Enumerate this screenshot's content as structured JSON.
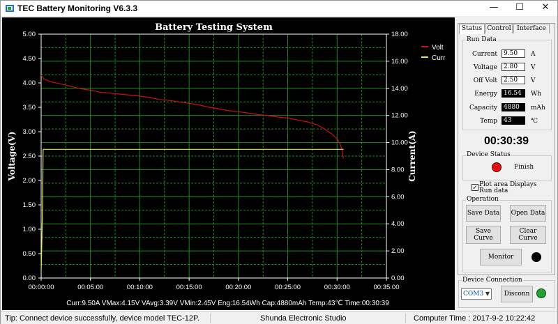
{
  "window": {
    "title": "TEC Battery Monitoring V6.3.3",
    "minimize": "—",
    "maximize": "☐",
    "close": "✕"
  },
  "tabs": [
    {
      "label": "Status",
      "active": true
    },
    {
      "label": "Control",
      "active": false
    },
    {
      "label": "Interface",
      "active": false
    }
  ],
  "run_data": {
    "label": "Run Data",
    "rows": [
      {
        "label": "Current",
        "value": "9.50",
        "unit": "A"
      },
      {
        "label": "Voltage",
        "value": "2.80",
        "unit": "V"
      },
      {
        "label": "Off Volt",
        "value": "2.50",
        "unit": "V"
      },
      {
        "label": "Energy",
        "value": "16.54",
        "unit": "Wh"
      },
      {
        "label": "Capacity",
        "value": "4880",
        "unit": "mAh"
      },
      {
        "label": "Temp",
        "value": "43",
        "unit": "℃"
      }
    ]
  },
  "timer": "00:30:39",
  "device_status": {
    "label": "Device Status",
    "status_text": "Finish",
    "color": "#e01010"
  },
  "plot_option": {
    "checked": true,
    "check_glyph": "✓",
    "label_line1": "Plot area Displays",
    "label_line2": "Run data"
  },
  "operation": {
    "label": "Operation",
    "save_data": "Save Data",
    "open_data": "Open Data",
    "save_curve_1": "Save",
    "save_curve_2": "Curve",
    "clear_curve_1": "Clear",
    "clear_curve_2": "Curve",
    "monitor": "Monitor",
    "monitor_indicator_color": "#000000"
  },
  "device_connection": {
    "label": "Device Connection",
    "port": "COM3",
    "disconnect": "Disconn",
    "indicator_color": "#22a030"
  },
  "status_bar": {
    "tip": "Tip: Connect device successfully, device model TEC-12P.",
    "studio": "Shunda Electronic Studio",
    "computer_time": "Computer Time : 2017-9-2 10:22:42"
  },
  "chart_data": {
    "type": "line",
    "title": "Battery Testing System",
    "ylabel": "Voltage(V)",
    "y2label": "Current(A)",
    "ylim": [
      0,
      5
    ],
    "y2lim": [
      0,
      18
    ],
    "yticks": [
      "0.00",
      "0.50",
      "1.00",
      "1.50",
      "2.00",
      "2.50",
      "3.00",
      "3.50",
      "4.00",
      "4.50",
      "5.00"
    ],
    "y2ticks": [
      "0.00",
      "2.00",
      "4.00",
      "6.00",
      "8.00",
      "10.00",
      "12.00",
      "14.00",
      "16.00",
      "18.00"
    ],
    "xticks": [
      "00:00:00",
      "00:05:00",
      "00:10:00",
      "00:15:00",
      "00:20:00",
      "00:25:00",
      "00:30:00",
      "00:35:00"
    ],
    "xlim_minutes": [
      0,
      35
    ],
    "grid": true,
    "legend_position": "top-right",
    "summary": "Curr:9.50A  VMax:4.15V  VAvg:3.39V  VMin:2.45V  Eng:16.54Wh  Cap:4880mAh  Temp:43℃  Time:00:30:39",
    "colors": {
      "volt": "#cc1010",
      "curr": "#e8e840",
      "grid": "#1e8a1e",
      "axes": "#ffffff"
    },
    "series": [
      {
        "name": "Volt",
        "axis": "left",
        "x_minutes": [
          0,
          0.3,
          1,
          2,
          3,
          4,
          5,
          6,
          7,
          8,
          9,
          10,
          11,
          12,
          13,
          14,
          15,
          16,
          17,
          18,
          19,
          20,
          21,
          22,
          23,
          24,
          25,
          26,
          27,
          28,
          28.5,
          29,
          29.5,
          30,
          30.3,
          30.5,
          30.65
        ],
        "y": [
          4.15,
          4.08,
          4.02,
          3.98,
          3.93,
          3.88,
          3.85,
          3.81,
          3.79,
          3.77,
          3.75,
          3.73,
          3.7,
          3.66,
          3.64,
          3.61,
          3.58,
          3.55,
          3.5,
          3.47,
          3.43,
          3.41,
          3.38,
          3.35,
          3.33,
          3.3,
          3.28,
          3.24,
          3.2,
          3.14,
          3.08,
          3.02,
          2.95,
          2.85,
          2.75,
          2.62,
          2.45
        ]
      },
      {
        "name": "Curr",
        "axis": "right",
        "x_minutes": [
          0,
          0.05,
          0.1,
          0.15,
          0.2,
          30.65
        ],
        "y": [
          0.5,
          2.0,
          3.8,
          5.5,
          9.5,
          9.5
        ]
      }
    ]
  }
}
